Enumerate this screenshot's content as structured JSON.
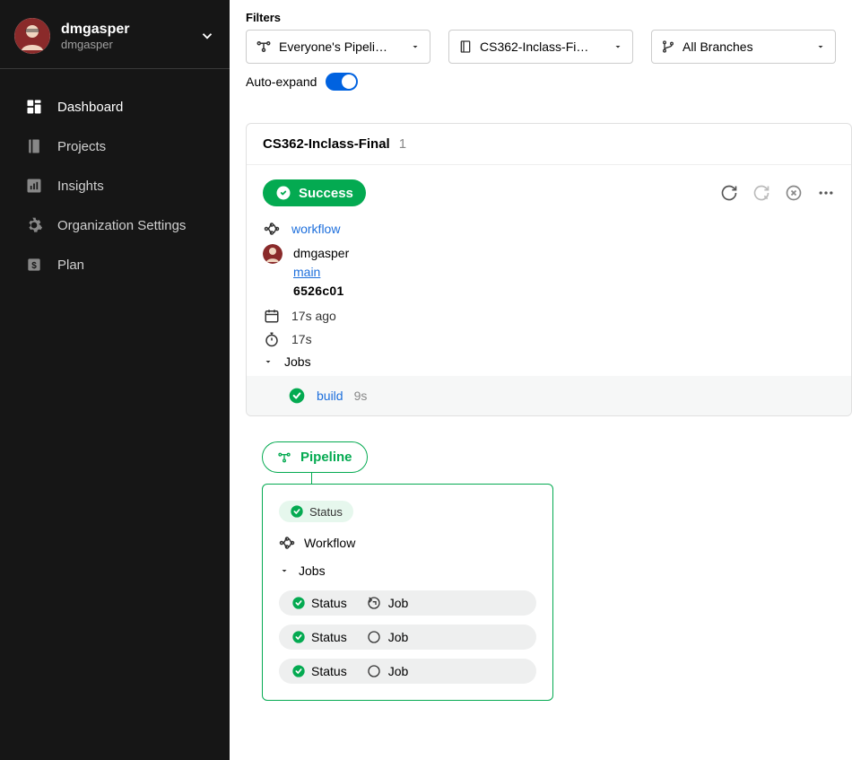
{
  "sidebar": {
    "user_name": "dmgasper",
    "user_sub": "dmgasper",
    "items": [
      {
        "label": "Dashboard",
        "icon": "dashboard-icon"
      },
      {
        "label": "Projects",
        "icon": "projects-icon"
      },
      {
        "label": "Insights",
        "icon": "insights-icon"
      },
      {
        "label": "Organization Settings",
        "icon": "gear-icon"
      },
      {
        "label": "Plan",
        "icon": "plan-icon"
      }
    ]
  },
  "filters": {
    "label": "Filters",
    "pipelines": "Everyone's Pipeli…",
    "project": "CS362-Inclass-Fi…",
    "branches": "All Branches",
    "autoexpand_label": "Auto-expand"
  },
  "pipeline": {
    "title": "CS362-Inclass-Final",
    "count": "1",
    "status": "Success",
    "workflow_label": "workflow",
    "user": "dmgasper",
    "branch": "main",
    "commit": "6526c01",
    "time_ago": "17s ago",
    "duration": "17s",
    "jobs_label": "Jobs",
    "jobs": [
      {
        "name": "build",
        "duration": "9s"
      }
    ]
  },
  "legend": {
    "tag": "Pipeline",
    "status_label": "Status",
    "workflow_label": "Workflow",
    "jobs_label": "Jobs",
    "job_label": "Job"
  }
}
